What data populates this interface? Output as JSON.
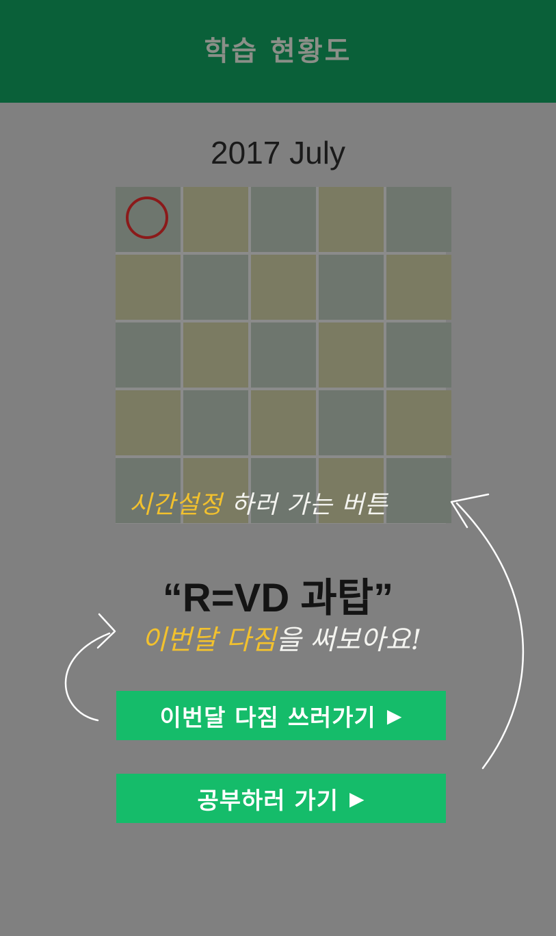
{
  "header": {
    "title": "학습 현황도"
  },
  "calendar": {
    "month_label": "2017 July",
    "today_cell": 0
  },
  "time_hint": {
    "highlight": "시간설정",
    "rest": " 하러 가는 버튼"
  },
  "motto": "“R=VD 과탑”",
  "resolution_hint": {
    "highlight": "이번달 다짐",
    "rest": "을 써보아요!"
  },
  "buttons": {
    "resolution": {
      "label": "이번달 다짐 쓰러가기",
      "arrow": "▶"
    },
    "study": {
      "label": "공부하러 가기",
      "arrow": "▶"
    }
  },
  "colors": {
    "header_bg": "#0a6039",
    "button_bg": "#15bc6a",
    "cell_a": "#6e766e",
    "cell_b": "#7b7b62",
    "today_ring": "#8b1a1a",
    "highlight": "#f2c12e"
  }
}
